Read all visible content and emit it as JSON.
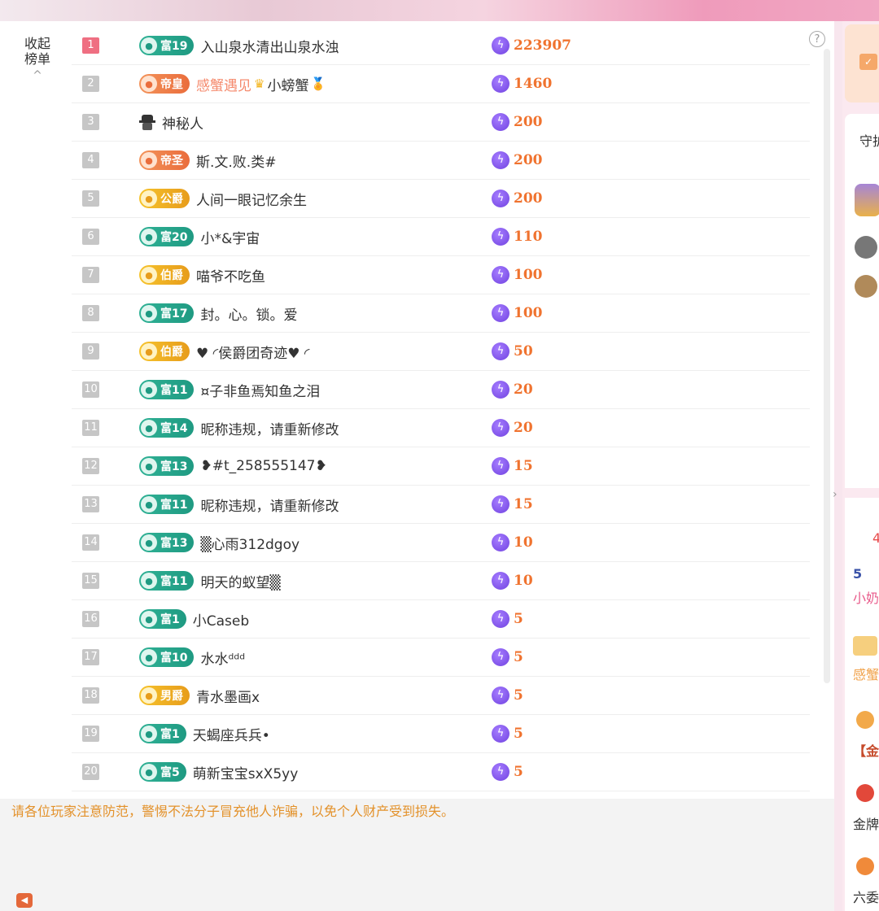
{
  "collapse_label": [
    "收起",
    "榜单"
  ],
  "collapse_chevron": "^",
  "help_icon": "?",
  "notice": "请各位玩家注意防范，警惕不法分子冒充他人诈骗，以免个人财产受到损失。",
  "rows": [
    {
      "rank": "1",
      "badge_type": "fu",
      "badge": "富19",
      "name": "入山泉水清出山泉水浊",
      "score": "223907"
    },
    {
      "rank": "2",
      "badge_type": "di",
      "badge": "帝皇",
      "name_prefix": "感蟹遇见",
      "name": "小螃蟹",
      "score": "1460"
    },
    {
      "rank": "3",
      "badge_type": "mystery",
      "name": "神秘人",
      "score": "200"
    },
    {
      "rank": "4",
      "badge_type": "di",
      "badge": "帝圣",
      "name": "斯.文.败.类#",
      "score": "200"
    },
    {
      "rank": "5",
      "badge_type": "jue",
      "badge": "公爵",
      "name": "人间一眼记忆余生",
      "score": "200"
    },
    {
      "rank": "6",
      "badge_type": "fu",
      "badge": "富20",
      "name": "小*&宇宙",
      "score": "110"
    },
    {
      "rank": "7",
      "badge_type": "jue",
      "badge": "伯爵",
      "name": "喵爷不吃鱼",
      "score": "100"
    },
    {
      "rank": "8",
      "badge_type": "fu",
      "badge": "富17",
      "name": "封。心。锁。爱",
      "score": "100"
    },
    {
      "rank": "9",
      "badge_type": "jue",
      "badge": "伯爵",
      "name": "♥ ◜侯爵团奇迹♥ ◜",
      "score": "50"
    },
    {
      "rank": "10",
      "badge_type": "fu",
      "badge": "富11",
      "name": "¤子非鱼焉知鱼之泪",
      "score": "20"
    },
    {
      "rank": "11",
      "badge_type": "fu",
      "badge": "富14",
      "name": "昵称违规，请重新修改",
      "score": "20"
    },
    {
      "rank": "12",
      "badge_type": "fu",
      "badge": "富13",
      "name": "❥#t_258555147❥",
      "score": "15"
    },
    {
      "rank": "13",
      "badge_type": "fu",
      "badge": "富11",
      "name": "昵称违规，请重新修改",
      "score": "15"
    },
    {
      "rank": "14",
      "badge_type": "fu",
      "badge": "富13",
      "name": "▒心雨312dgoy",
      "score": "10"
    },
    {
      "rank": "15",
      "badge_type": "fu",
      "badge": "富11",
      "name": "明天的蚁望▒",
      "score": "10"
    },
    {
      "rank": "16",
      "badge_type": "fu",
      "badge": "富1",
      "name": "小Caseb",
      "score": "5"
    },
    {
      "rank": "17",
      "badge_type": "fu",
      "badge": "富10",
      "name": "水水ᵈᵈᵈ",
      "score": "5"
    },
    {
      "rank": "18",
      "badge_type": "jue",
      "badge": "男爵",
      "name": "青水墨画x",
      "score": "5"
    },
    {
      "rank": "19",
      "badge_type": "fu",
      "badge": "富1",
      "name": "天蝎座兵兵•",
      "score": "5"
    },
    {
      "rank": "20",
      "badge_type": "fu",
      "badge": "富5",
      "name": "萌新宝宝sxX5yy",
      "score": "5"
    }
  ],
  "side": {
    "guard_label": "守护",
    "count_red": "4",
    "item_5": "5",
    "nickname_1": "小奶",
    "nickname_2": "感蟹",
    "bracket": "【金",
    "gold": "金牌",
    "six": "六委"
  }
}
